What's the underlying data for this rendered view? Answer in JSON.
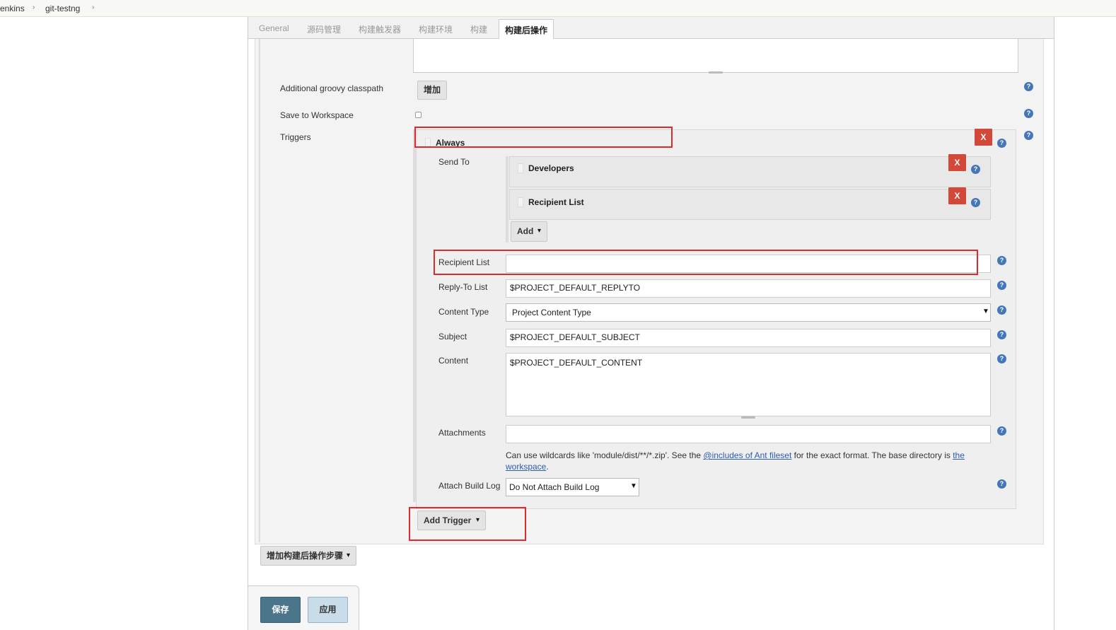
{
  "breadcrumb": {
    "items": [
      "enkins",
      "git-testng"
    ],
    "sep": "›"
  },
  "tabs": [
    "General",
    "源码管理",
    "构建触发器",
    "构建环境",
    "构建",
    "构建后操作"
  ],
  "fields": {
    "groovy_label": "Additional groovy classpath",
    "groovy_button": "增加",
    "save_ws_label": "Save to Workspace",
    "triggers_label": "Triggers"
  },
  "trigger": {
    "name": "Always",
    "delete_label": "X",
    "send_to_label": "Send To",
    "recipients": [
      {
        "name": "Developers",
        "delete_label": "X"
      },
      {
        "name": "Recipient List",
        "delete_label": "X"
      }
    ],
    "add_label": "Add",
    "recipient_list_label": "Recipient List",
    "recipient_list_value": "",
    "reply_to_label": "Reply-To List",
    "reply_to_value": "$PROJECT_DEFAULT_REPLYTO",
    "content_type_label": "Content Type",
    "content_type_value": "Project Content Type",
    "subject_label": "Subject",
    "subject_value": "$PROJECT_DEFAULT_SUBJECT",
    "content_label": "Content",
    "content_value": "$PROJECT_DEFAULT_CONTENT",
    "attachments_label": "Attachments",
    "attachments_value": "",
    "hint_pre": "Can use wildcards like 'module/dist/**/*.zip'. See the ",
    "hint_link1": "@includes of Ant fileset",
    "hint_mid": " for the exact format. The base directory is ",
    "hint_link2a": "the",
    "hint_link2b": "workspace",
    "hint_end": ".",
    "attach_log_label": "Attach Build Log",
    "attach_log_value": "Do Not Attach Build Log"
  },
  "add_trigger_label": "Add Trigger",
  "add_post_step_label": "增加构建后操作步骤",
  "save_label": "保存",
  "apply_label": "应用",
  "help_glyph": "?",
  "caret_glyph": "▾",
  "select_caret_glyph": "▼",
  "colors": {
    "delete_button": "#d24939",
    "highlight_box": "#e0292e",
    "save_button": "#4b758b",
    "help_icon": "#4477b8"
  }
}
